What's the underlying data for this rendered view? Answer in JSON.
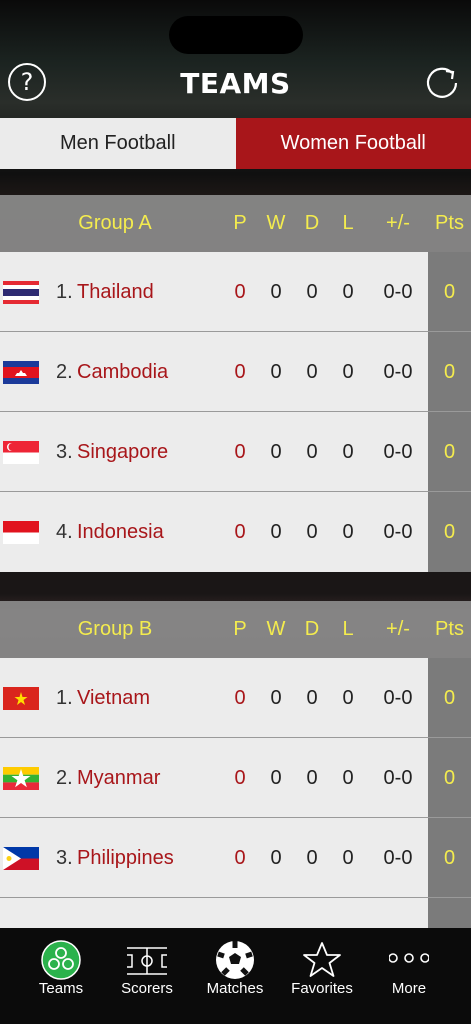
{
  "header": {
    "title": "TEAMS",
    "help_glyph": "?"
  },
  "segments": {
    "men": "Men Football",
    "women": "Women Football",
    "selected": "women"
  },
  "columns": {
    "p": "P",
    "w": "W",
    "d": "D",
    "l": "L",
    "gd": "+/-",
    "pts": "Pts"
  },
  "groups": [
    {
      "name": "Group A",
      "teams": [
        {
          "index": "1.",
          "name": "Thailand",
          "flag": "thailand-flag",
          "p": "0",
          "w": "0",
          "d": "0",
          "l": "0",
          "gd": "0-0",
          "pts": "0"
        },
        {
          "index": "2.",
          "name": "Cambodia",
          "flag": "cambodia-flag",
          "p": "0",
          "w": "0",
          "d": "0",
          "l": "0",
          "gd": "0-0",
          "pts": "0"
        },
        {
          "index": "3.",
          "name": "Singapore",
          "flag": "singapore-flag",
          "p": "0",
          "w": "0",
          "d": "0",
          "l": "0",
          "gd": "0-0",
          "pts": "0"
        },
        {
          "index": "4.",
          "name": "Indonesia",
          "flag": "indonesia-flag",
          "p": "0",
          "w": "0",
          "d": "0",
          "l": "0",
          "gd": "0-0",
          "pts": "0"
        }
      ]
    },
    {
      "name": "Group B",
      "teams": [
        {
          "index": "1.",
          "name": "Vietnam",
          "flag": "vietnam-flag",
          "p": "0",
          "w": "0",
          "d": "0",
          "l": "0",
          "gd": "0-0",
          "pts": "0"
        },
        {
          "index": "2.",
          "name": "Myanmar",
          "flag": "myanmar-flag",
          "p": "0",
          "w": "0",
          "d": "0",
          "l": "0",
          "gd": "0-0",
          "pts": "0"
        },
        {
          "index": "3.",
          "name": "Philippines",
          "flag": "philippines-flag",
          "p": "0",
          "w": "0",
          "d": "0",
          "l": "0",
          "gd": "0-0",
          "pts": "0"
        }
      ]
    }
  ],
  "tabs": [
    {
      "label": "Teams",
      "icon": "teams-icon",
      "active": true
    },
    {
      "label": "Scorers",
      "icon": "pitch-icon"
    },
    {
      "label": "Matches",
      "icon": "soccer-ball-icon"
    },
    {
      "label": "Favorites",
      "icon": "star-icon"
    },
    {
      "label": "More",
      "icon": "more-dots-icon"
    }
  ],
  "colors": {
    "accent": "#a8161a",
    "highlight": "#f4ec4e",
    "active_tab": "#2bb24c"
  }
}
